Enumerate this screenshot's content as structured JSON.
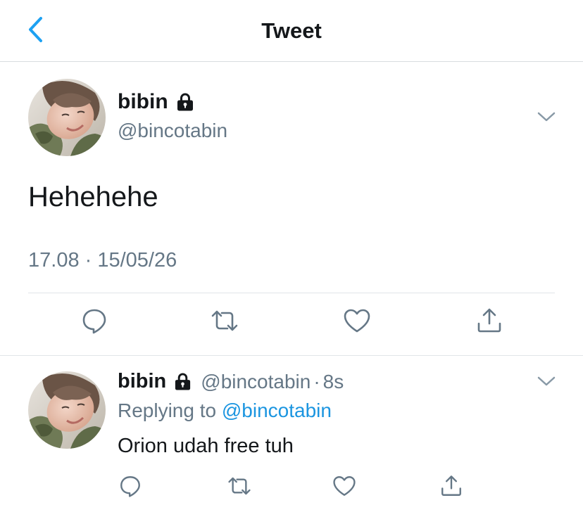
{
  "header": {
    "title": "Tweet",
    "back_icon": "chevron-left-icon"
  },
  "main_tweet": {
    "display_name": "bibin",
    "protected_icon": "lock-icon",
    "handle": "@bincotabin",
    "text": "Hehehehe",
    "timestamp": "17.08 · 15/05/26",
    "actions": [
      "reply-icon",
      "retweet-icon",
      "like-icon",
      "share-icon"
    ]
  },
  "reply_tweet": {
    "display_name": "bibin",
    "handle": "@bincotabin",
    "separator": "·",
    "time": "8s",
    "replying_label": "Replying to",
    "replying_to": "@bincotabin",
    "text": "Orion udah free tuh",
    "actions": [
      "reply-icon",
      "retweet-icon",
      "like-icon",
      "share-icon"
    ]
  },
  "colors": {
    "accent": "#1da1f2",
    "link": "#1b95e0",
    "text_primary": "#14171a",
    "text_secondary": "#657786",
    "divider": "#e1e5e8"
  }
}
